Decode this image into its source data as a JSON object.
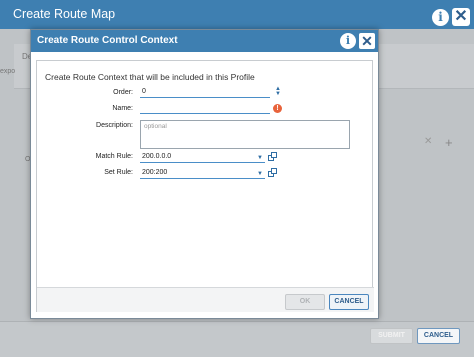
{
  "outer": {
    "title": "Create Route Map",
    "frag_de": "De",
    "frag_exp": "expo",
    "frag_or": "Or",
    "submit_label": "SUBMIT",
    "cancel_label": "CANCEL"
  },
  "modal": {
    "title": "Create Route Control Context",
    "description": "Create Route Context that will be included in this Profile",
    "fields": {
      "order": {
        "label": "Order:",
        "value": "0"
      },
      "name": {
        "label": "Name:",
        "value": ""
      },
      "description": {
        "label": "Description:",
        "placeholder": "optional"
      },
      "match_rule": {
        "label": "Match Rule:",
        "value": "200.0.0.0"
      },
      "set_rule": {
        "label": "Set Rule:",
        "value": "200:200"
      }
    },
    "ok_label": "OK",
    "cancel_label": "CANCEL"
  },
  "colors": {
    "header_blue": "#3e7fb1",
    "warning_orange": "#e8633b",
    "input_underline": "#4a8ec8"
  },
  "icons": [
    "info-icon",
    "close-icon",
    "spinner-icon",
    "warning-icon",
    "dropdown-caret-icon",
    "copy-link-icon",
    "plus-icon"
  ]
}
